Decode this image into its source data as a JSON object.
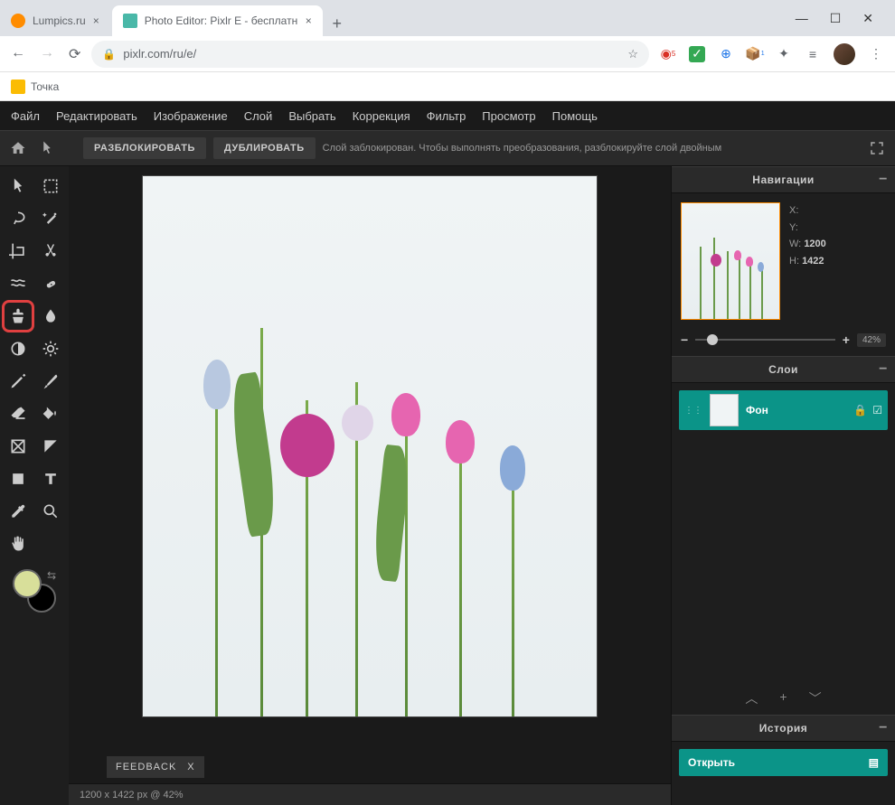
{
  "browser": {
    "tabs": [
      {
        "title": "Lumpics.ru",
        "favicon_color": "#ff8c00"
      },
      {
        "title": "Photo Editor: Pixlr E - бесплатны",
        "favicon_color": "#4ab8a8"
      }
    ],
    "url": "pixlr.com/ru/e/",
    "bookmark": "Точка"
  },
  "menu": [
    "Файл",
    "Редактировать",
    "Изображение",
    "Слой",
    "Выбрать",
    "Коррекция",
    "Фильтр",
    "Просмотр",
    "Помощь"
  ],
  "option_bar": {
    "unlock": "РАЗБЛОКИРОВАТЬ",
    "duplicate": "ДУБЛИРОВАТЬ",
    "message": "Слой заблокирован. Чтобы выполнять преобразования, разблокируйте слой двойным"
  },
  "panels": {
    "navigation": {
      "title": "Навигации",
      "x_label": "X:",
      "y_label": "Y:",
      "w_label": "W:",
      "h_label": "H:",
      "w_value": "1200",
      "h_value": "1422",
      "zoom": "42%"
    },
    "layers": {
      "title": "Слои",
      "items": [
        {
          "name": "Фон"
        }
      ]
    },
    "history": {
      "title": "История",
      "items": [
        {
          "label": "Открыть"
        }
      ]
    }
  },
  "feedback": {
    "label": "FEEDBACK",
    "close": "X"
  },
  "status": "1200 x 1422 px @ 42%"
}
